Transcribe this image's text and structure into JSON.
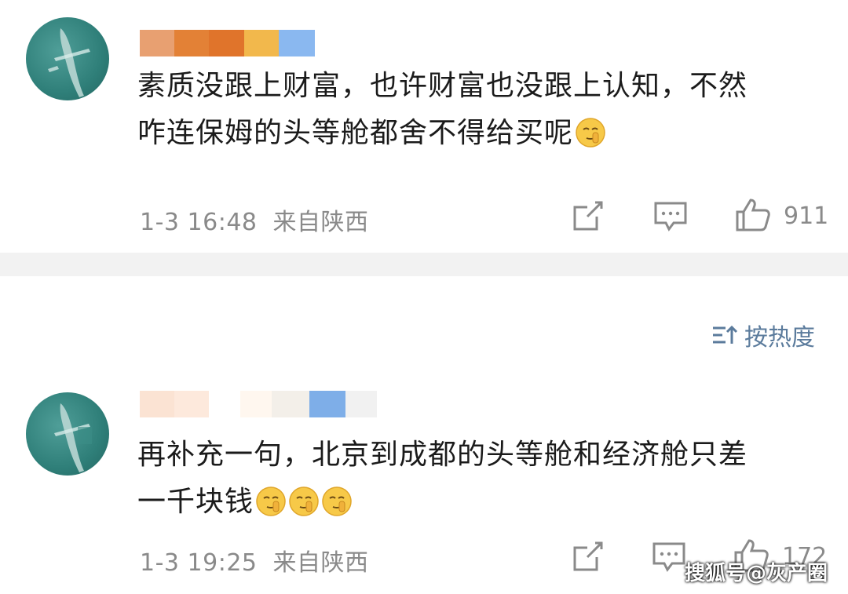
{
  "comments": [
    {
      "text_line1": "素质没跟上财富，也许财富也没跟上认知，不然",
      "text_line2": "咋连保姆的头等舱都舍不得给买呢",
      "emoji_count": 1,
      "time": "1-3 16:48",
      "location": "来自陕西",
      "likes": "911"
    },
    {
      "text_line1": "再补充一句，北京到成都的头等舱和经济舱只差",
      "text_line2": "一千块钱",
      "emoji_count": 3,
      "time": "1-3 19:25",
      "location": "来自陕西",
      "likes": "172"
    }
  ],
  "sort": {
    "label": "按热度",
    "icon": "sort-icon"
  },
  "icons": {
    "share": "share-icon",
    "comment": "comment-icon",
    "like": "thumbs-up-icon",
    "emoji": "shush-emoji"
  },
  "colors": {
    "accent": "#5b7b9c",
    "meta": "#8a8a8a",
    "divider": "#f2f2f2"
  },
  "watermark": "搜狐号@灰产圈"
}
